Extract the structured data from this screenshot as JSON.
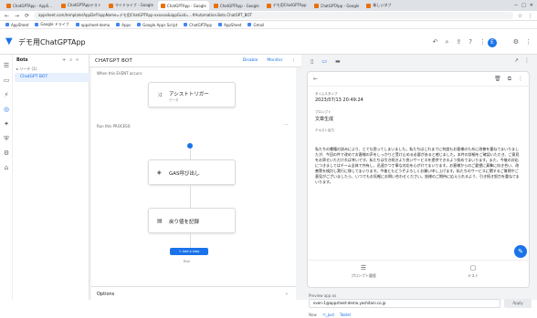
{
  "browser": {
    "tabs": [
      {
        "label": "ChatGPTApp - AppSheet",
        "active": false
      },
      {
        "label": "ChatGPTAppテスト",
        "active": false
      },
      {
        "label": "マイドライブ - Google",
        "active": false
      },
      {
        "label": "ChatGPTApp - Google",
        "active": true
      },
      {
        "label": "ChatGPTApp - Google",
        "active": false
      },
      {
        "label": "デモ用ChatGPTApp",
        "active": false
      },
      {
        "label": "ChatGPTApp - Google",
        "active": false
      },
      {
        "label": "新しいタブ",
        "active": false
      }
    ],
    "url": "appsheet.com/template/AppDef?appName=デモ用ChatGPTApp-xxxxxx&appGuid=...#Automation.Bots.ChatGPT_BOT",
    "bookmarks": [
      "AppSheet",
      "Google ドライブ",
      "appsheet-demo",
      "Apps",
      "Google Apps Script",
      "ChatGPTApp",
      "AppSheet",
      "Gmail"
    ]
  },
  "app": {
    "title": "デモ用ChatGPTApp",
    "avatar_letter": "E"
  },
  "sidebar": {
    "heading": "Bots",
    "subheading": "▸ リーチ (1)",
    "items": [
      {
        "label": "ChatGPT BOT"
      }
    ]
  },
  "editor": {
    "title": "CHATGPT BOT",
    "actions": [
      "Disable",
      "Monitor"
    ],
    "event_label": "When this EVENT occurs:",
    "event_name": "アシストトリガー",
    "event_sub": "データ",
    "process_label": "Run this PROCESS:",
    "steps": [
      {
        "name": "GAS呼び出し"
      },
      {
        "name": "戻り値を記録"
      }
    ],
    "add_step": "+ Add a step",
    "end": "End",
    "options": "Options"
  },
  "preview": {
    "toolbar_icons": [
      "phone-icon",
      "tablet-icon",
      "desktop-icon"
    ],
    "fields": [
      {
        "label": "タイムスタンプ",
        "value": "2023/07/13 20:49:24"
      },
      {
        "label": "プロンプト",
        "value": "文章生成"
      },
      {
        "label": "テキスト出力",
        "value": ""
      }
    ],
    "body_text": "私たちの書籍の試みにより、とても困ってしまいました。私たちはこれまでに何度もお客様のために改善を重ねてまいりましたが、今回の件で改めてお客様の声をしっかりと受け止める必要があると感じました。本件の詳細をご確認いただき、ご意見をお寄せいただければ幸いです。私たちは引き続きより良いサービスを提供できるよう努めてまいります。また、今後の対応につきましてはチーム全体で共有し、迅速かつ丁寧な対応を心がけてまいります。お客様からのご要望に真摯に向き合い、改善策を検討し実行に移してまいります。今後ともどうぞよろしくお願い申し上げます。私たちのサービスに関するご質問やご意見がございましたら、いつでもお気軽にお問い合わせください。皆様のご期待に応えられるよう、引き続き努力を重ねてまいります。",
    "tabs": [
      {
        "label": "プロンプト履歴",
        "icon": "list-icon"
      },
      {
        "label": "テスト",
        "icon": "chat-icon"
      }
    ],
    "preview_as_label": "Preview app as",
    "preview_user": "even-1@appsheet-demo.yoshitani.co.jp",
    "apply_label": "Apply",
    "footer": [
      "Now",
      "ペ_Just",
      "Tablet"
    ]
  }
}
